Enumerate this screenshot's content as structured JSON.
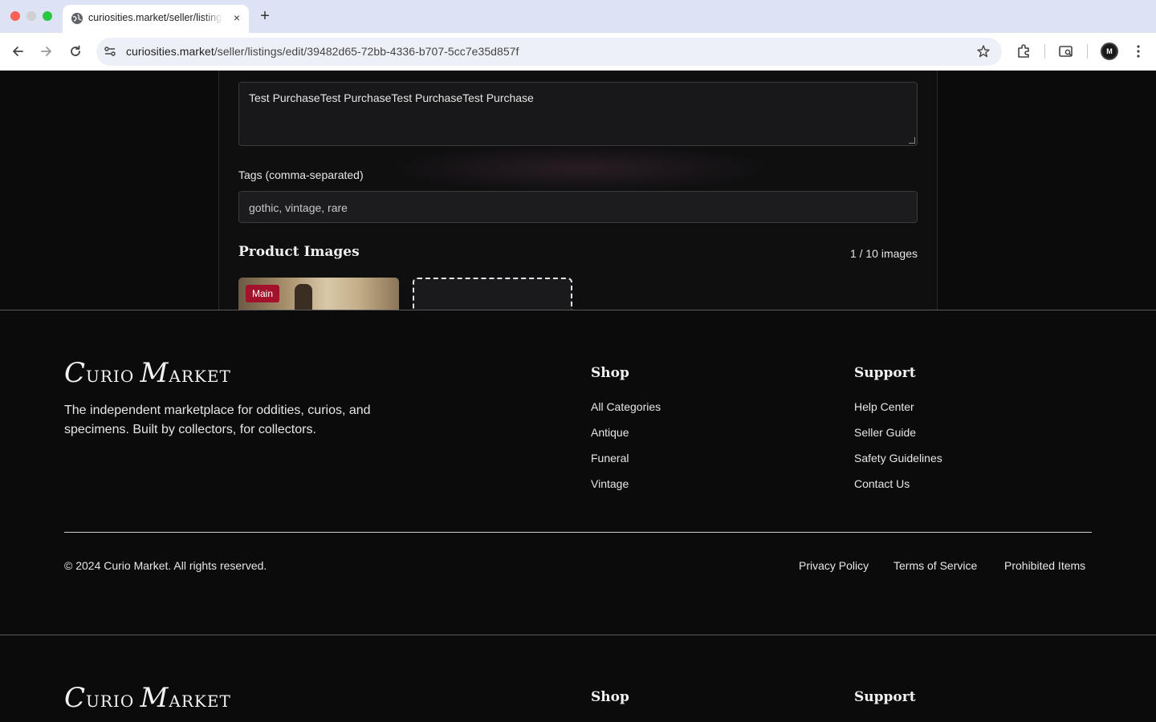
{
  "browser": {
    "tab_title": "curiosities.market/seller/listings/edit/39482d65-72bb-4336-b707-5cc7e35d857f",
    "tab_close": "×",
    "new_tab": "+",
    "url_host": "curiosities.market",
    "url_path": "/seller/listings/edit/39482d65-72bb-4336-b707-5cc7e35d857f",
    "profile_initials": "M"
  },
  "form": {
    "description_value": "Test PurchaseTest PurchaseTest PurchaseTest Purchase",
    "tags_label": "Tags (comma-separated)",
    "tags_value": "gothic, vintage, rare",
    "images_heading": "Product Images",
    "images_count": "1 / 10 images",
    "main_badge": "Main"
  },
  "footer": {
    "logo_c": "C",
    "logo_urio": "URIO ",
    "logo_m": "M",
    "logo_arket": "ARKET",
    "tagline": "The independent marketplace for oddities, curios, and specimens. Built by collectors, for collectors.",
    "shop_heading": "Shop",
    "shop_links": [
      "All Categories",
      "Antique",
      "Funeral",
      "Vintage"
    ],
    "support_heading": "Support",
    "support_links": [
      "Help Center",
      "Seller Guide",
      "Safety Guidelines",
      "Contact Us"
    ],
    "copyright": "© 2024 Curio Market. All rights reserved.",
    "legal_links": [
      "Privacy Policy",
      "Terms of Service",
      "Prohibited Items"
    ]
  },
  "colors": {
    "background": "#0b0b0c",
    "accent_badge": "#a3112b",
    "text": "#e6e6e6"
  }
}
